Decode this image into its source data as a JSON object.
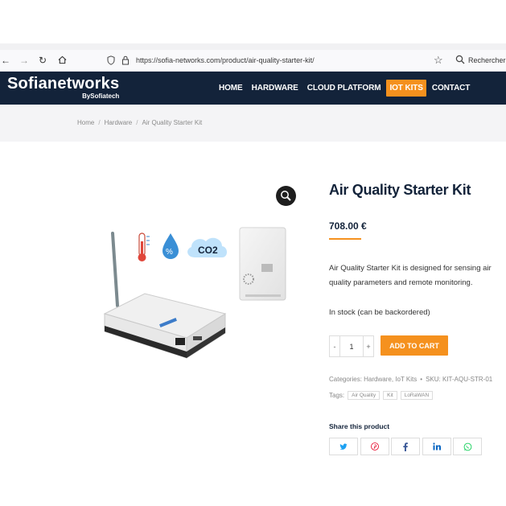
{
  "browser": {
    "back_icon": "back-arrow-icon",
    "forward_icon": "forward-arrow-icon",
    "reload_icon": "reload-icon",
    "home_icon": "home-icon",
    "url": "https://sofia-networks.com/product/air-quality-starter-kit/",
    "search_placeholder": "Rechercher"
  },
  "header": {
    "logo_text": "Sofianetworks",
    "logo_sub": "BySofiatech",
    "menu": [
      {
        "label": "HOME"
      },
      {
        "label": "HARDWARE"
      },
      {
        "label": "CLOUD PLATFORM"
      },
      {
        "label": "IOT KITS",
        "active": true
      },
      {
        "label": "CONTACT"
      }
    ],
    "bg_color": "#13233a",
    "accent_color": "#f5911e"
  },
  "breadcrumb": {
    "items": [
      "Home",
      "Hardware",
      "Air Quality Starter Kit"
    ],
    "separator": "/"
  },
  "product": {
    "title": "Air Quality Starter Kit",
    "price": "708.00 €",
    "description": "Air Quality Starter Kit is designed for sensing air quality parameters and remote monitoring.",
    "stock": "In stock (can be backordered)",
    "quantity": "1",
    "minus": "-",
    "plus": "+",
    "add_to_cart": "ADD TO CART",
    "categories_label": "Categories:",
    "categories": "Hardware, IoT Kits",
    "sku_label": "SKU:",
    "sku": "KIT-AQU-STR-01",
    "tags_label": "Tags:",
    "tags": [
      "Air Quality",
      "Kit",
      "LoRaWAN"
    ],
    "image_label": "CO2"
  },
  "share": {
    "title": "Share this product",
    "buttons": [
      "twitter-icon",
      "pinterest-icon",
      "facebook-icon",
      "linkedin-icon",
      "whatsapp-icon"
    ]
  }
}
